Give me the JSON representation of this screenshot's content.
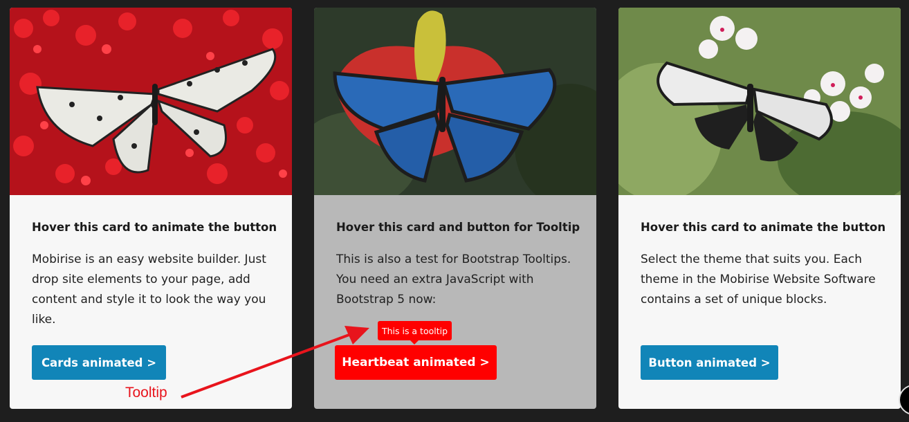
{
  "cards": [
    {
      "image": "white-black-butterfly-on-red-flowers",
      "title": "Hover this card to animate the button",
      "text": "Mobirise is an easy website builder. Just drop site elements to your page, add content and style it to look the way you like.",
      "button": "Cards animated >"
    },
    {
      "image": "blue-morpho-butterfly-on-anthurium",
      "title": "Hover this card and button for Tooltip",
      "text": "This is also a test for Bootstrap Tooltips. You need an extra JavaScript with Bootstrap 5 now:",
      "button": "Heartbeat animated >",
      "tooltip": "This is a tooltip"
    },
    {
      "image": "black-white-butterfly-on-pink-flowers",
      "title": "Hover this card to animate the button",
      "text": "Select the theme that suits you. Each theme in the Mobirise Website Software contains a set of unique blocks.",
      "button": "Button animated >"
    }
  ],
  "annotation": {
    "label": "Tooltip"
  },
  "colors": {
    "page_background": "#1e1e1e",
    "card_background": "#f7f7f7",
    "hover_card_background": "#b8b8b8",
    "blue_button": "#1185b8",
    "red_button": "#ff0000",
    "annotation_red": "#e8141c"
  },
  "icons": [
    "scroll-to-top-icon"
  ]
}
